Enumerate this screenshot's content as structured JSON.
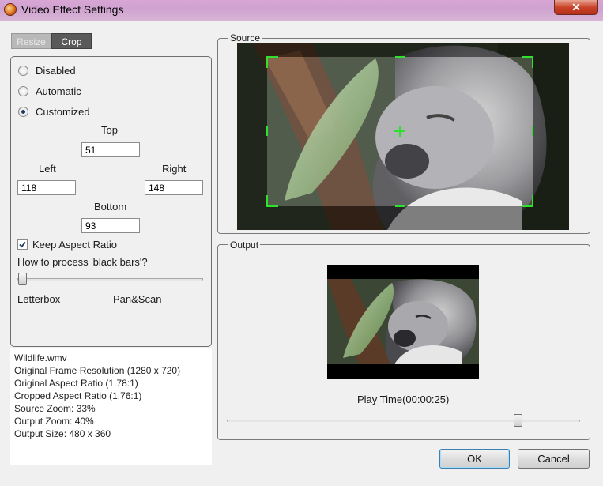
{
  "window": {
    "title": "Video Effect Settings",
    "close_label": "✕"
  },
  "tabs": [
    {
      "label": "Resize",
      "active": false
    },
    {
      "label": "Crop",
      "active": true
    }
  ],
  "crop_mode": {
    "options": [
      {
        "label": "Disabled",
        "checked": false
      },
      {
        "label": "Automatic",
        "checked": false
      },
      {
        "label": "Customized",
        "checked": true
      }
    ]
  },
  "crop": {
    "top_label": "Top",
    "top_value": "51",
    "left_label": "Left",
    "left_value": "118",
    "right_label": "Right",
    "right_value": "148",
    "bottom_label": "Bottom",
    "bottom_value": "93"
  },
  "keep_aspect": {
    "label": "Keep Aspect Ratio",
    "checked": true
  },
  "black_bars": {
    "question": "How to process 'black bars'?",
    "min_label": "Letterbox",
    "max_label": "Pan&Scan",
    "value": 0
  },
  "info_lines": [
    "Wildlife.wmv",
    "Original Frame Resolution  (1280 x 720)",
    "Original Aspect Ratio (1.78:1)",
    "Cropped Aspect Ratio (1.76:1)",
    "Source Zoom:  33%",
    "Output Zoom:  40%",
    "Output Size:  480 x 360"
  ],
  "source": {
    "title": "Source",
    "crosshair_color": "#2fe02f"
  },
  "output": {
    "title": "Output",
    "play_time_label": "Play Time(00:00:25)",
    "play_position": 0.97
  },
  "buttons": {
    "ok_label": "OK",
    "cancel_label": "Cancel"
  }
}
